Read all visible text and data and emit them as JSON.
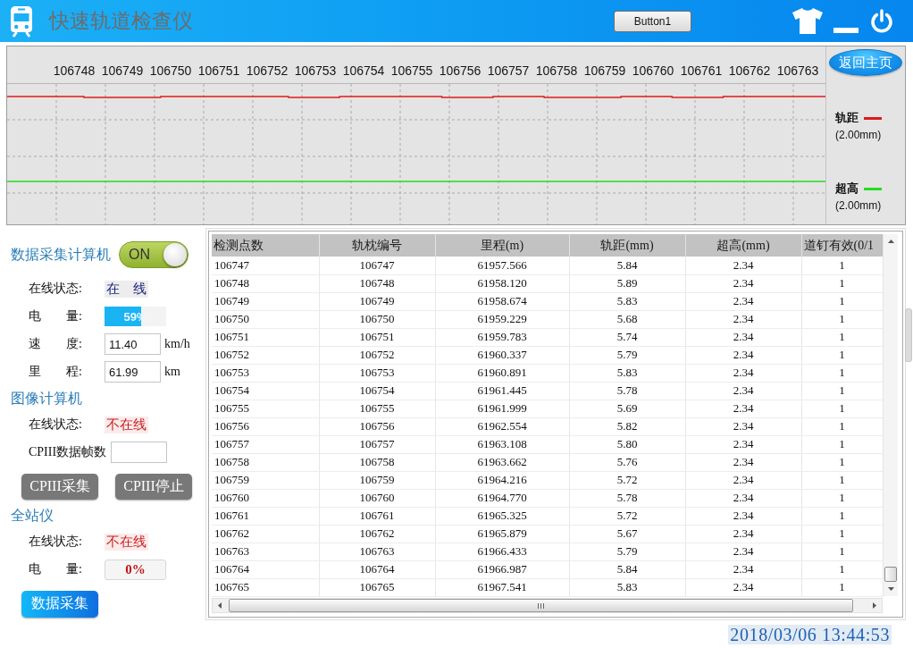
{
  "title_bar": {
    "title": "快速轨道检查仪",
    "button": "Button1"
  },
  "chart": {
    "x_labels": [
      "106748",
      "106749",
      "106750",
      "106751",
      "106752",
      "106753",
      "106754",
      "106755",
      "106756",
      "106757",
      "106758",
      "106759",
      "106760",
      "106761",
      "106762",
      "106763"
    ],
    "home_button": "返回主页",
    "legend": [
      {
        "name": "轨距",
        "scale": "(2.00mm)",
        "color": "#e01818"
      },
      {
        "name": "超高",
        "scale": "(2.00mm)",
        "color": "#22dd22"
      }
    ]
  },
  "sections": [
    {
      "title": "数据采集计算机",
      "switch": {
        "label": "ON",
        "on": true
      },
      "rows": [
        {
          "kind": "status",
          "label": "在线状态:",
          "value": "在　线",
          "online": true
        },
        {
          "kind": "meter",
          "label": "电　　量:",
          "reading": "59%",
          "level": 0.59
        },
        {
          "kind": "input",
          "label": "速　　度:",
          "value": "11.40",
          "unit": "km/h"
        },
        {
          "kind": "input",
          "label": "里　　程:",
          "value": "61.99",
          "unit": "km"
        }
      ]
    },
    {
      "title": "图像计算机",
      "rows": [
        {
          "kind": "status",
          "label": "在线状态:",
          "value": "不在线",
          "online": false
        },
        {
          "kind": "input",
          "label": "CPIII数据帧数"
        },
        {
          "kind": "buttons",
          "buttons": [
            {
              "label": "CPIII采集",
              "disabled": true
            },
            {
              "label": "CPIII停止",
              "disabled": true
            }
          ]
        }
      ]
    },
    {
      "title": "全站仪",
      "rows": [
        {
          "kind": "status",
          "label": "在线状态:",
          "value": "不在线",
          "online": false
        },
        {
          "kind": "readout",
          "label": "电　　量:",
          "value": "0%"
        },
        {
          "kind": "buttons",
          "buttons": [
            {
              "label": "数据采集",
              "disabled": false
            }
          ]
        }
      ]
    }
  ],
  "table": {
    "columns": [
      "检测点数",
      "轨枕编号",
      "里程(m)",
      "轨距(mm)",
      "超高(mm)",
      "道钉有效(0/1"
    ],
    "rows": [
      [
        "106747",
        "106747",
        "61957.566",
        "5.84",
        "2.34",
        "1"
      ],
      [
        "106748",
        "106748",
        "61958.120",
        "5.89",
        "2.34",
        "1"
      ],
      [
        "106749",
        "106749",
        "61958.674",
        "5.83",
        "2.34",
        "1"
      ],
      [
        "106750",
        "106750",
        "61959.229",
        "5.68",
        "2.34",
        "1"
      ],
      [
        "106751",
        "106751",
        "61959.783",
        "5.74",
        "2.34",
        "1"
      ],
      [
        "106752",
        "106752",
        "61960.337",
        "5.79",
        "2.34",
        "1"
      ],
      [
        "106753",
        "106753",
        "61960.891",
        "5.83",
        "2.34",
        "1"
      ],
      [
        "106754",
        "106754",
        "61961.445",
        "5.78",
        "2.34",
        "1"
      ],
      [
        "106755",
        "106755",
        "61961.999",
        "5.69",
        "2.34",
        "1"
      ],
      [
        "106756",
        "106756",
        "61962.554",
        "5.82",
        "2.34",
        "1"
      ],
      [
        "106757",
        "106757",
        "61963.108",
        "5.80",
        "2.34",
        "1"
      ],
      [
        "106758",
        "106758",
        "61963.662",
        "5.76",
        "2.34",
        "1"
      ],
      [
        "106759",
        "106759",
        "61964.216",
        "5.72",
        "2.34",
        "1"
      ],
      [
        "106760",
        "106760",
        "61964.770",
        "5.78",
        "2.34",
        "1"
      ],
      [
        "106761",
        "106761",
        "61965.325",
        "5.72",
        "2.34",
        "1"
      ],
      [
        "106762",
        "106762",
        "61965.879",
        "5.67",
        "2.34",
        "1"
      ],
      [
        "106763",
        "106763",
        "61966.433",
        "5.79",
        "2.34",
        "1"
      ],
      [
        "106764",
        "106764",
        "61966.987",
        "5.84",
        "2.34",
        "1"
      ],
      [
        "106765",
        "106765",
        "61967.541",
        "5.83",
        "2.34",
        "1"
      ]
    ]
  },
  "datetime": "2018/03/06 13:44:53"
}
